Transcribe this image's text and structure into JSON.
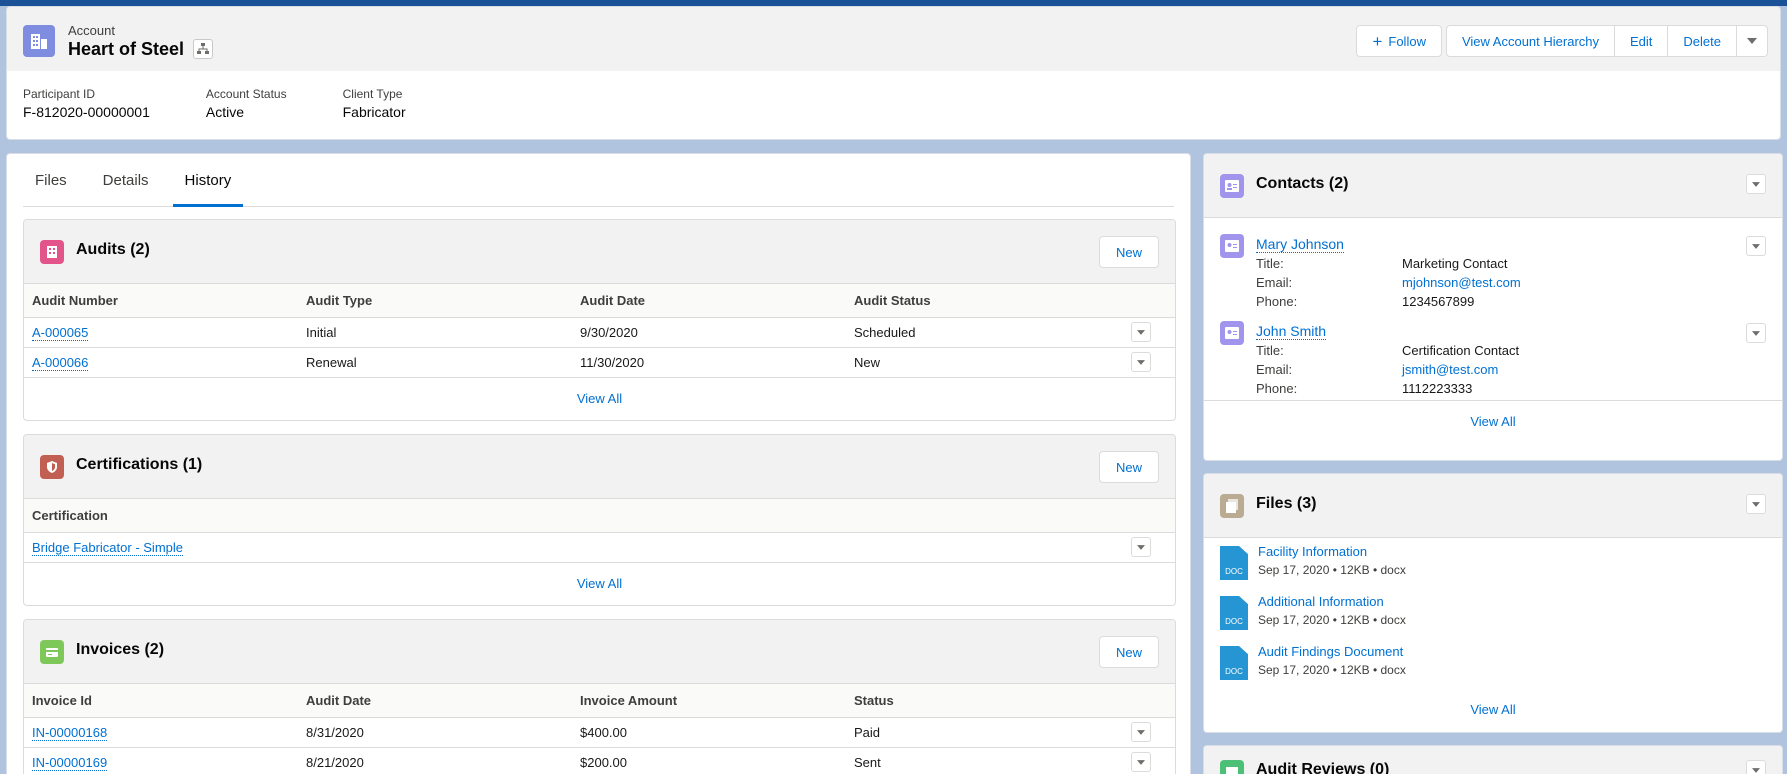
{
  "header": {
    "object_label": "Account",
    "record_name": "Heart of Steel",
    "actions": {
      "follow": "Follow",
      "view_hierarchy": "View Account Hierarchy",
      "edit": "Edit",
      "delete": "Delete"
    },
    "highlights": [
      {
        "label": "Participant ID",
        "value": "F-812020-00000001"
      },
      {
        "label": "Account Status",
        "value": "Active"
      },
      {
        "label": "Client Type",
        "value": "Fabricator"
      }
    ]
  },
  "tabs": [
    "Files",
    "Details",
    "History"
  ],
  "active_tab": "History",
  "audits": {
    "title": "Audits (2)",
    "new_label": "New",
    "columns": [
      "Audit Number",
      "Audit Type",
      "Audit Date",
      "Audit Status"
    ],
    "rows": [
      [
        "A-000065",
        "Initial",
        "9/30/2020",
        "Scheduled"
      ],
      [
        "A-000066",
        "Renewal",
        "11/30/2020",
        "New"
      ]
    ],
    "view_all": "View All"
  },
  "certifications": {
    "title": "Certifications (1)",
    "new_label": "New",
    "columns": [
      "Certification"
    ],
    "rows": [
      [
        "Bridge Fabricator - Simple"
      ]
    ],
    "view_all": "View All"
  },
  "invoices": {
    "title": "Invoices (2)",
    "new_label": "New",
    "columns": [
      "Invoice Id",
      "Audit Date",
      "Invoice Amount",
      "Status"
    ],
    "rows": [
      [
        "IN-00000168",
        "8/31/2020",
        "$400.00",
        "Paid"
      ],
      [
        "IN-00000169",
        "8/21/2020",
        "$200.00",
        "Sent"
      ]
    ]
  },
  "contacts": {
    "title": "Contacts (2)",
    "items": [
      {
        "name": "Mary Johnson",
        "title_label": "Title:",
        "title": "Marketing Contact",
        "email_label": "Email:",
        "email": "mjohnson@test.com",
        "phone_label": "Phone:",
        "phone": "1234567899"
      },
      {
        "name": "John Smith",
        "title_label": "Title:",
        "title": "Certification Contact",
        "email_label": "Email:",
        "email": "jsmith@test.com",
        "phone_label": "Phone:",
        "phone": "1112223333"
      }
    ],
    "view_all": "View All"
  },
  "files": {
    "title": "Files (3)",
    "doc_label": "DOC",
    "items": [
      {
        "name": "Facility Information",
        "meta": "Sep 17, 2020 • 12KB • docx"
      },
      {
        "name": "Additional Information",
        "meta": "Sep 17, 2020 • 12KB • docx"
      },
      {
        "name": "Audit Findings Document",
        "meta": "Sep 17, 2020 • 12KB • docx"
      }
    ],
    "view_all": "View All"
  },
  "audit_reviews": {
    "title": "Audit Reviews (0)"
  },
  "colors": {
    "brand": "#0070d2",
    "account_icon": "#7f8de1",
    "audits_icon": "#e3548a",
    "cert_icon": "#c15f53",
    "invoice_icon": "#7ec859",
    "contact_icon": "#a094ed",
    "files_icon": "#baac93"
  }
}
